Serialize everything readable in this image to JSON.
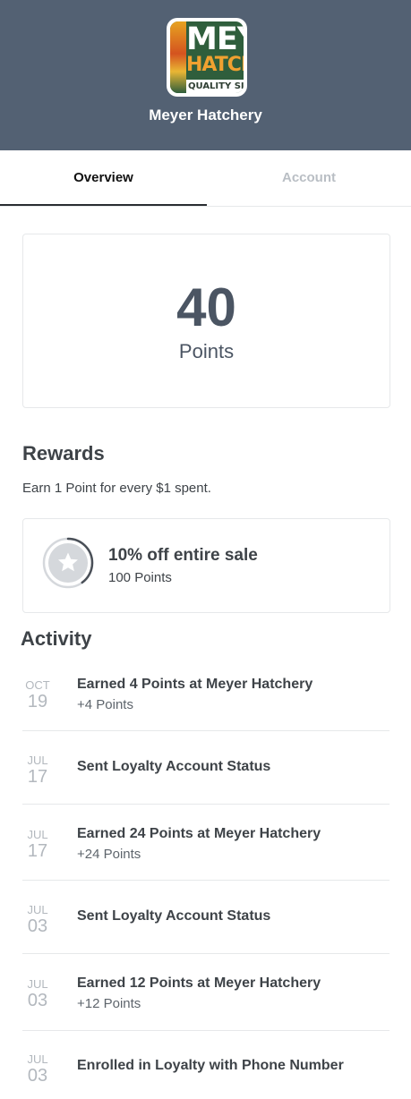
{
  "header": {
    "logo": {
      "line1": "MEYI",
      "line2": "HATCHI",
      "line3": "QUALITY SINC"
    },
    "store_name": "Meyer Hatchery"
  },
  "tabs": [
    {
      "label": "Overview",
      "active": true
    },
    {
      "label": "Account",
      "active": false
    }
  ],
  "points": {
    "value": "40",
    "label": "Points"
  },
  "rewards": {
    "title": "Rewards",
    "description": "Earn 1 Point for every $1 spent.",
    "items": [
      {
        "name": "10% off entire sale",
        "cost": "100 Points",
        "progress": 0.4,
        "icon": "star-icon"
      }
    ]
  },
  "activity": {
    "title": "Activity",
    "items": [
      {
        "month": "OCT",
        "day": "19",
        "title": "Earned 4 Points at Meyer Hatchery",
        "subtitle": "+4 Points"
      },
      {
        "month": "JUL",
        "day": "17",
        "title": "Sent Loyalty Account Status",
        "subtitle": ""
      },
      {
        "month": "JUL",
        "day": "17",
        "title": "Earned 24 Points at Meyer Hatchery",
        "subtitle": "+24 Points"
      },
      {
        "month": "JUL",
        "day": "03",
        "title": "Sent Loyalty Account Status",
        "subtitle": ""
      },
      {
        "month": "JUL",
        "day": "03",
        "title": "Earned 12 Points at Meyer Hatchery",
        "subtitle": "+12 Points"
      },
      {
        "month": "JUL",
        "day": "03",
        "title": "Enrolled in Loyalty with Phone Number",
        "subtitle": ""
      }
    ]
  },
  "colors": {
    "header_bg": "#536173",
    "text": "#3e4348",
    "muted": "#b3b8be",
    "ring_track": "#d5d8dc",
    "ring_progress": "#4a5058"
  }
}
